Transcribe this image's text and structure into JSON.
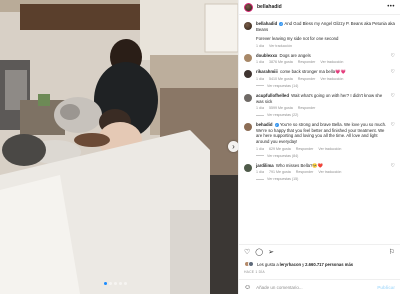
{
  "post": {
    "username": "bellahadid",
    "caption_user": "bellahadid",
    "caption_text": "And God Bless my Angel Glizzy P. Beans aka Petunia aka Beans",
    "caption_line2": "Forever leaving my side not for one second",
    "caption_meta": {
      "time": "1 día",
      "translate": "Ver traducción"
    },
    "photo_colors": {
      "wall": "#d8d0c6",
      "blanket": "#ece9e4",
      "floor": "#8a7766"
    }
  },
  "comments": [
    {
      "user": "doublexxx",
      "text": "Dogs are angels",
      "time": "1 día",
      "likes": "3876 Me gusta",
      "reply": "Responder",
      "translate": "Ver traducción",
      "verified": false
    },
    {
      "user": "rikarahmiii",
      "text": "come back stronger ma bella💗💗",
      "time": "1 día",
      "likes": "5410 Me gusta",
      "reply": "Responder",
      "translate": "Ver traducción",
      "verified": false,
      "replies": "Ver respuestas (14)"
    },
    {
      "user": "acupfullofhelled",
      "text": "Wait what's going on with her? I didn't know she was sick",
      "time": "1 día",
      "likes": "5599 Me gusta",
      "reply": "Responder",
      "translate": "",
      "verified": false,
      "replies": "Ver respuestas (22)"
    },
    {
      "user": "behadid",
      "text": "You're so strong and brave Bella. We love you so much. We're so happy that you feel better and finished your treatment. We are here supporting and loving you all the time. All love and light around you everyday!",
      "time": "1 día",
      "likes": "629 Me gusta",
      "reply": "Responder",
      "translate": "Ver traducción",
      "verified": true,
      "replies": "Ver respuestas (84)"
    },
    {
      "user": "jardilima",
      "text": "Who misses Bella?🥺❤️",
      "time": "1 día",
      "likes": "791 Me gusta",
      "reply": "Responder",
      "translate": "Ver traducción",
      "verified": false,
      "replies": "Ver respuestas (15)"
    }
  ],
  "actions": {
    "likes_prefix": "Les gusta a",
    "likes_user": "leryrhacon",
    "likes_middle": "y",
    "likes_count": "2.660.717 personas más",
    "date": "HACE 1 DÍA"
  },
  "comment_box": {
    "placeholder": "Añade un comentario...",
    "publish": "Publicar"
  },
  "icons": [
    "heart-icon",
    "comment-icon",
    "share-icon",
    "bookmark-icon",
    "emoji-icon",
    "more-icon",
    "verified-icon",
    "chevron-right-icon"
  ]
}
